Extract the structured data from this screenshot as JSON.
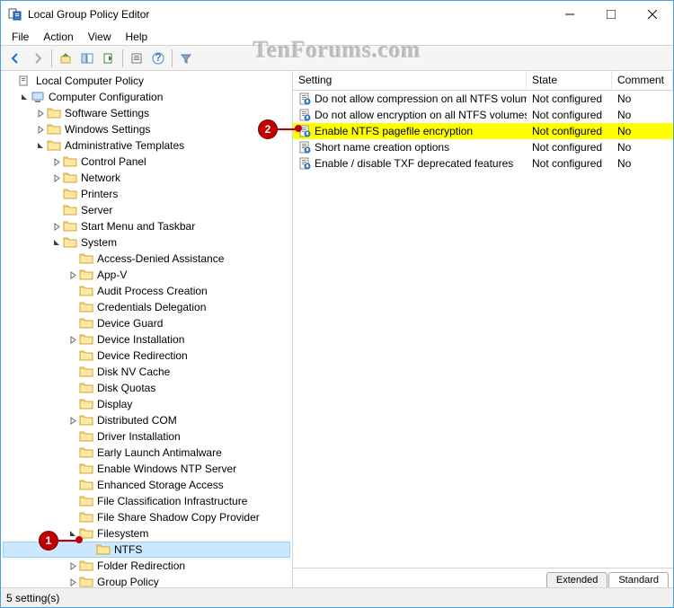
{
  "window": {
    "title": "Local Group Policy Editor"
  },
  "menu": {
    "file": "File",
    "action": "Action",
    "view": "View",
    "help": "Help"
  },
  "watermark": "TenForums.com",
  "tree": {
    "root": "Local Computer Policy",
    "computer_config": "Computer Configuration",
    "software_settings": "Software Settings",
    "windows_settings": "Windows Settings",
    "admin_templates": "Administrative Templates",
    "control_panel": "Control Panel",
    "network": "Network",
    "printers": "Printers",
    "server": "Server",
    "start_taskbar": "Start Menu and Taskbar",
    "system": "System",
    "sys_children": [
      "Access-Denied Assistance",
      "App-V",
      "Audit Process Creation",
      "Credentials Delegation",
      "Device Guard",
      "Device Installation",
      "Device Redirection",
      "Disk NV Cache",
      "Disk Quotas",
      "Display",
      "Distributed COM",
      "Driver Installation",
      "Early Launch Antimalware",
      "Enable Windows NTP Server",
      "Enhanced Storage Access",
      "File Classification Infrastructure",
      "File Share Shadow Copy Provider",
      "Filesystem",
      "NTFS",
      "Folder Redirection",
      "Group Policy"
    ]
  },
  "columns": {
    "setting": "Setting",
    "state": "State",
    "comment": "Comment"
  },
  "settings": [
    {
      "name": "Do not allow compression on all NTFS volumes",
      "state": "Not configured",
      "comment": "No"
    },
    {
      "name": "Do not allow encryption on all NTFS volumes",
      "state": "Not configured",
      "comment": "No"
    },
    {
      "name": "Enable NTFS pagefile encryption",
      "state": "Not configured",
      "comment": "No"
    },
    {
      "name": "Short name creation options",
      "state": "Not configured",
      "comment": "No"
    },
    {
      "name": "Enable / disable TXF deprecated features",
      "state": "Not configured",
      "comment": "No"
    }
  ],
  "tabs": {
    "extended": "Extended",
    "standard": "Standard"
  },
  "status": "5 setting(s)",
  "callouts": {
    "one": "1",
    "two": "2"
  }
}
